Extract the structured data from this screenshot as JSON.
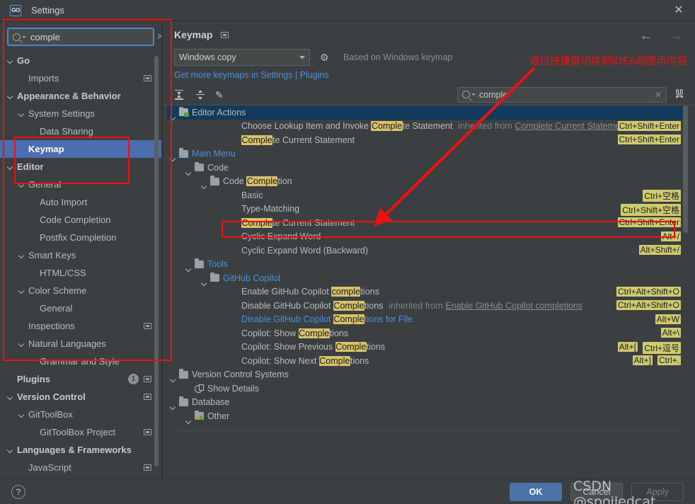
{
  "window": {
    "app_icon": "GO",
    "title": "Settings",
    "close_label": "✕"
  },
  "sidebar": {
    "search": {
      "value": "comple",
      "placeholder": "",
      "clear_label": "✕"
    },
    "items": [
      {
        "label": "Go",
        "depth": 0,
        "bold": true,
        "chevron": true,
        "ext": false
      },
      {
        "label": "Imports",
        "depth": 1,
        "bold": false,
        "chevron": false,
        "ext": true
      },
      {
        "label": "Appearance & Behavior",
        "depth": 0,
        "bold": true,
        "chevron": true,
        "ext": false
      },
      {
        "label": "System Settings",
        "depth": 1,
        "bold": false,
        "chevron": true,
        "ext": false
      },
      {
        "label": "Data Sharing",
        "depth": 2,
        "bold": false,
        "chevron": false,
        "ext": false
      },
      {
        "label": "Keymap",
        "depth": 1,
        "bold": true,
        "chevron": false,
        "ext": false,
        "selected": true
      },
      {
        "label": "Editor",
        "depth": 0,
        "bold": true,
        "chevron": true,
        "ext": false
      },
      {
        "label": "General",
        "depth": 1,
        "bold": false,
        "chevron": true,
        "ext": false
      },
      {
        "label": "Auto Import",
        "depth": 2,
        "bold": false,
        "chevron": false,
        "ext": false
      },
      {
        "label": "Code Completion",
        "depth": 2,
        "bold": false,
        "chevron": false,
        "ext": false
      },
      {
        "label": "Postfix Completion",
        "depth": 2,
        "bold": false,
        "chevron": false,
        "ext": false
      },
      {
        "label": "Smart Keys",
        "depth": 1,
        "bold": false,
        "chevron": true,
        "ext": false
      },
      {
        "label": "HTML/CSS",
        "depth": 2,
        "bold": false,
        "chevron": false,
        "ext": false
      },
      {
        "label": "Color Scheme",
        "depth": 1,
        "bold": false,
        "chevron": true,
        "ext": false
      },
      {
        "label": "General",
        "depth": 2,
        "bold": false,
        "chevron": false,
        "ext": false
      },
      {
        "label": "Inspections",
        "depth": 1,
        "bold": false,
        "chevron": false,
        "ext": true
      },
      {
        "label": "Natural Languages",
        "depth": 1,
        "bold": false,
        "chevron": true,
        "ext": false
      },
      {
        "label": "Grammar and Style",
        "depth": 2,
        "bold": false,
        "chevron": false,
        "ext": false
      },
      {
        "label": "Plugins",
        "depth": 0,
        "bold": true,
        "chevron": false,
        "ext": true,
        "badge": "1"
      },
      {
        "label": "Version Control",
        "depth": 0,
        "bold": true,
        "chevron": true,
        "ext": true
      },
      {
        "label": "GitToolBox",
        "depth": 1,
        "bold": false,
        "chevron": true,
        "ext": false
      },
      {
        "label": "GitToolBox Project",
        "depth": 2,
        "bold": false,
        "chevron": false,
        "ext": true
      },
      {
        "label": "Languages & Frameworks",
        "depth": 0,
        "bold": true,
        "chevron": true,
        "ext": false
      },
      {
        "label": "JavaScript",
        "depth": 1,
        "bold": false,
        "chevron": false,
        "ext": true
      }
    ]
  },
  "panel": {
    "title": "Keymap",
    "nav_back": "←",
    "nav_forward": "→",
    "keymap_select_value": "Windows copy",
    "gear_icon": "⚙",
    "based_on": "Based on Windows keymap",
    "keymaps_link": "Get more keymaps in Settings | Plugins",
    "toolbar": {
      "expand_all": "expand-all-icon",
      "collapse_all": "collapse-all-icon",
      "edit_shortcut": "✎"
    },
    "find": {
      "value": "comple",
      "placeholder": "",
      "clear_label": "✕"
    },
    "filter_icon": "☲"
  },
  "keymap_tree": [
    {
      "id": "editor-actions",
      "indent": 0,
      "chevron": true,
      "icon": "editor-actions",
      "label": "Editor Actions",
      "selected": true
    },
    {
      "id": "choose-lookup",
      "indent": 4,
      "chevron": false,
      "icon": "none",
      "pre": "Choose Lookup Item and Invoke ",
      "hl": "Comple",
      "post": "te Statement",
      "inherit_prefix": "inherited from ",
      "inherit_link": "Complete Current Statement",
      "shortcut": "Ctrl+Shift+Enter"
    },
    {
      "id": "complete-current-1",
      "indent": 4,
      "chevron": false,
      "icon": "none",
      "pre": "",
      "hl": "Comple",
      "post": "te Current Statement",
      "shortcut": "Ctrl+Shift+Enter"
    },
    {
      "id": "main-menu",
      "indent": 0,
      "chevron": true,
      "icon": "mainmenu",
      "label": "Main Menu",
      "blue": true
    },
    {
      "id": "code",
      "indent": 1,
      "chevron": true,
      "icon": "folder",
      "label": "Code"
    },
    {
      "id": "code-completion",
      "indent": 2,
      "chevron": true,
      "icon": "folder",
      "pre": "Code ",
      "hl": "Comple",
      "post": "tion"
    },
    {
      "id": "basic",
      "indent": 4,
      "chevron": false,
      "icon": "none",
      "label": "Basic",
      "shortcut": "Ctrl+空格"
    },
    {
      "id": "type-matching",
      "indent": 4,
      "chevron": false,
      "icon": "none",
      "label": "Type-Matching",
      "shortcut": "Ctrl+Shift+空格"
    },
    {
      "id": "complete-current-2",
      "indent": 4,
      "chevron": false,
      "icon": "none",
      "pre": "",
      "hl": "Comple",
      "post": "te Current Statement",
      "shortcut": "Ctrl+Shift+Enter"
    },
    {
      "id": "cyclic-expand",
      "indent": 4,
      "chevron": false,
      "icon": "none",
      "label": "Cyclic Expand Word",
      "shortcut": "Alt+/"
    },
    {
      "id": "cyclic-expand-back",
      "indent": 4,
      "chevron": false,
      "icon": "none",
      "label": "Cyclic Expand Word (Backward)",
      "shortcut": "Alt+Shift+/"
    },
    {
      "id": "tools",
      "indent": 1,
      "chevron": true,
      "icon": "folder",
      "label": "Tools",
      "blue": true
    },
    {
      "id": "github-copilot",
      "indent": 2,
      "chevron": true,
      "icon": "folder",
      "label": "GitHub Copilot",
      "blue": true
    },
    {
      "id": "enable-copilot",
      "indent": 4,
      "chevron": false,
      "icon": "none",
      "pre": "Enable GitHub Copilot ",
      "hl": "comple",
      "post": "tions",
      "shortcut": "Ctrl+Alt+Shift+O"
    },
    {
      "id": "disable-copilot",
      "indent": 4,
      "chevron": false,
      "icon": "none",
      "pre": "Disable GitHub Copilot ",
      "hl": "Comple",
      "post": "tions",
      "inherit_prefix": "inherited from ",
      "inherit_link": "Enable GitHub Copilot completions",
      "shortcut": "Ctrl+Alt+Shift+O"
    },
    {
      "id": "disable-copilot-file",
      "indent": 4,
      "chevron": false,
      "icon": "none",
      "pre": "Disable GitHub Copilot ",
      "hl": "Comple",
      "post": "tions for File",
      "blue": true,
      "shortcut": "Alt+W"
    },
    {
      "id": "copilot-show",
      "indent": 4,
      "chevron": false,
      "icon": "none",
      "pre": "Copilot: Show ",
      "hl": "Comple",
      "post": "tions",
      "shortcut": "Alt+\\"
    },
    {
      "id": "copilot-show-prev",
      "indent": 4,
      "chevron": false,
      "icon": "none",
      "pre": "Copilot: Show Previous ",
      "hl": "Comple",
      "post": "tions",
      "shortcut": "Ctrl+逗号",
      "shortcut2": "Alt+["
    },
    {
      "id": "copilot-show-next",
      "indent": 4,
      "chevron": false,
      "icon": "none",
      "pre": "Copilot: Show Next ",
      "hl": "Comple",
      "post": "tions",
      "shortcut": "Ctrl+.",
      "shortcut2": "Alt+]"
    },
    {
      "id": "vcs",
      "indent": 0,
      "chevron": true,
      "icon": "folder",
      "label": "Version Control Systems"
    },
    {
      "id": "show-details",
      "indent": 1,
      "chevron": false,
      "icon": "vcs",
      "label": "Show Details"
    },
    {
      "id": "database",
      "indent": 0,
      "chevron": true,
      "icon": "folder",
      "label": "Database"
    },
    {
      "id": "other",
      "indent": 1,
      "chevron": true,
      "icon": "other",
      "label": "Other"
    }
  ],
  "footer": {
    "help_label": "?",
    "ok_label": "OK",
    "cancel_label": "Cancel",
    "apply_label": "Apply"
  },
  "annotation": {
    "note_text": "通过快捷键切换到IDEA的提示内容",
    "color": "#ee1111"
  },
  "watermark": {
    "text": "CSDN @spoiledcat"
  }
}
